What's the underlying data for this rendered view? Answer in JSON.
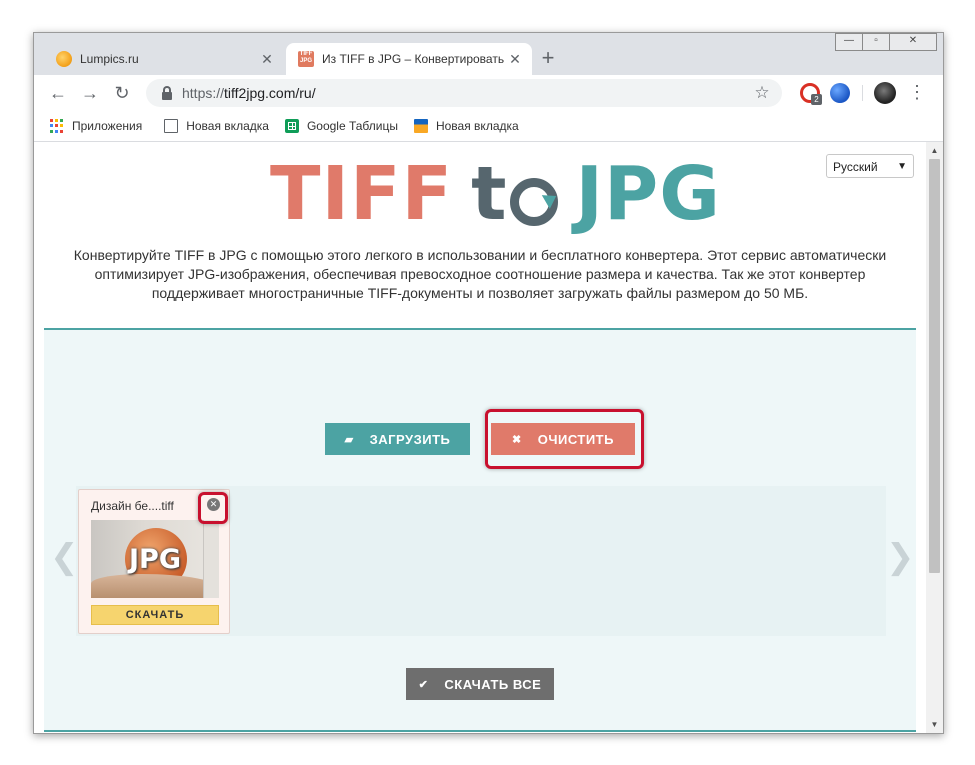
{
  "browser": {
    "tabs": [
      {
        "title": "Lumpics.ru",
        "active": false
      },
      {
        "title": "Из TIFF в JPG – Конвертировать",
        "active": true
      }
    ],
    "tab_favicon_text": "TIFF JPG",
    "url_scheme": "https://",
    "url_rest": "tiff2jpg.com/ru/",
    "extension_badge": "2",
    "bookmarks": [
      "Приложения",
      "Новая вкладка",
      "Google Таблицы",
      "Новая вкладка"
    ]
  },
  "site": {
    "language": "Русский",
    "logo": {
      "part1": "TIFF",
      "part2": "t",
      "part3": "JPG"
    },
    "description": "Конвертируйте TIFF в JPG с помощью этого легкого в использовании и бесплатного конвертера. Этот сервис автоматически оптимизирует JPG-изображения, обеспечивая превосходное соотношение размера и качества. Так же этот конвертер поддерживает многостраничные TIFF-документы и позволяет загружать файлы размером до 50 МБ.",
    "upload_label": "ЗАГРУЗИТЬ",
    "clear_label": "ОЧИСТИТЬ",
    "download_all_label": "СКАЧАТЬ ВСЕ",
    "files": [
      {
        "name": "Дизайн бе....tiff",
        "thumb_label": "JPG",
        "download_label": "СКАЧАТЬ"
      }
    ]
  },
  "colors": {
    "teal": "#4ca3a3",
    "coral": "#e07a6a",
    "highlight_red": "#c8102e",
    "download_yellow": "#f6d46e"
  },
  "icons": [
    "back-icon",
    "forward-icon",
    "reload-icon",
    "lock-icon",
    "star-icon",
    "folder-icon",
    "close-icon",
    "check-icon",
    "chevron-left-icon",
    "chevron-right-icon"
  ]
}
